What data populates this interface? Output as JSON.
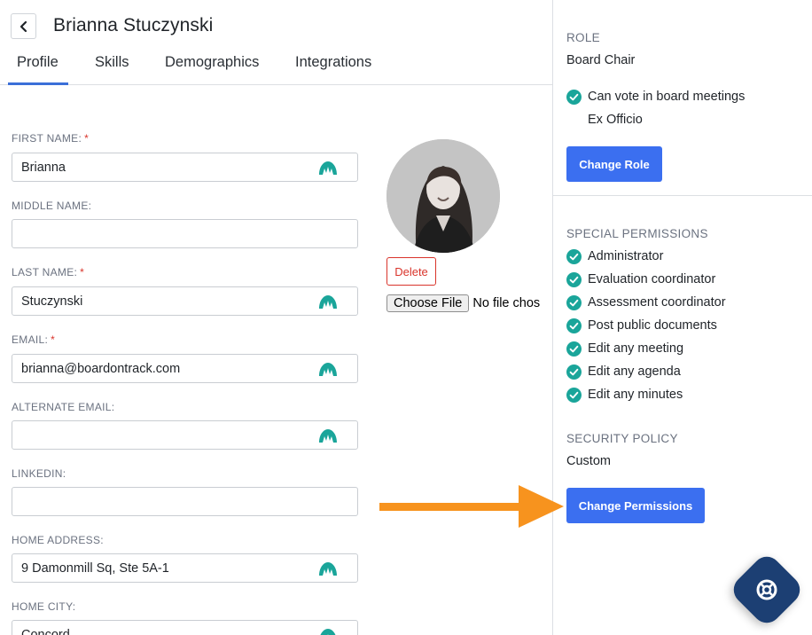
{
  "header": {
    "title": "Brianna Stuczynski",
    "tabs": [
      {
        "label": "Profile",
        "active": true
      },
      {
        "label": "Skills",
        "active": false
      },
      {
        "label": "Demographics",
        "active": false
      },
      {
        "label": "Integrations",
        "active": false
      }
    ]
  },
  "form": {
    "fields": [
      {
        "label": "FIRST NAME:",
        "required": true,
        "value": "Brianna",
        "lastpass": true
      },
      {
        "label": "MIDDLE NAME:",
        "required": false,
        "value": "",
        "lastpass": false
      },
      {
        "label": "LAST NAME:",
        "required": true,
        "value": "Stuczynski",
        "lastpass": true
      },
      {
        "label": "EMAIL:",
        "required": true,
        "value": "brianna@boardontrack.com",
        "lastpass": true
      },
      {
        "label": "ALTERNATE EMAIL:",
        "required": false,
        "value": "",
        "lastpass": true
      },
      {
        "label": "LINKEDIN:",
        "required": false,
        "value": "",
        "lastpass": false
      },
      {
        "label": "HOME ADDRESS:",
        "required": false,
        "value": "9 Damonmill Sq, Ste 5A-1",
        "lastpass": true
      },
      {
        "label": "HOME CITY:",
        "required": false,
        "value": "Concord",
        "lastpass": true
      }
    ],
    "required_mark": "*"
  },
  "photo": {
    "delete_label": "Delete",
    "choose_file_label": "Choose File",
    "file_status": "No file chosen"
  },
  "panel": {
    "role_heading": "ROLE",
    "role_value": "Board Chair",
    "role_checked": "Can vote in board meetings",
    "role_plain": "Ex Officio",
    "change_role_label": "Change Role",
    "special_heading": "SPECIAL PERMISSIONS",
    "permissions": [
      "Administrator",
      "Evaluation coordinator",
      "Assessment coordinator",
      "Post public documents",
      "Edit any meeting",
      "Edit any agenda",
      "Edit any minutes"
    ],
    "security_heading": "SECURITY POLICY",
    "security_value": "Custom",
    "change_permissions_label": "Change Permissions"
  },
  "colors": {
    "accent": "#3b6ff0",
    "check": "#1aa59a",
    "danger": "#d9342b",
    "arrow": "#f7931e",
    "help": "#1c3f73",
    "lastpass_icon": "#1aa59a"
  },
  "icons": {
    "back": "chevron-left-icon",
    "field": "lastpass-icon",
    "check": "check-circle-icon",
    "help": "lifebuoy-icon"
  }
}
